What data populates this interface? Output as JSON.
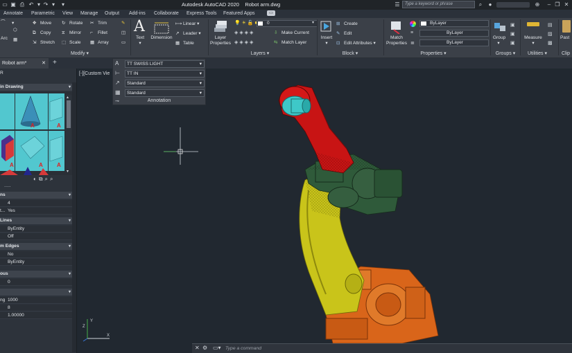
{
  "title_bar": {
    "app_title": "Autodesk AutoCAD 2020",
    "file_title": "Robot arm.dwg",
    "search_placeholder": "Type a keyword or phrase"
  },
  "menu_tabs": [
    "Annotate",
    "Parametric",
    "View",
    "Manage",
    "Output",
    "Add-ins",
    "Collaborate",
    "Express Tools",
    "Featured Apps"
  ],
  "ribbon": {
    "modify": {
      "title": "Modify",
      "tools": [
        "Move",
        "Rotate",
        "Trim",
        "Copy",
        "Mirror",
        "Fillet",
        "Stretch",
        "Scale",
        "Array"
      ],
      "left_label": "Arc"
    },
    "annotation": {
      "text_label": "Text",
      "dimension_label": "Dimension",
      "linear_label": "Linear",
      "leader_label": "Leader",
      "table_label": "Table"
    },
    "layers": {
      "title": "Layers",
      "properties_label": "Layer Properties",
      "current_layer": "0",
      "make_current": "Make Current",
      "match_layer": "Match Layer"
    },
    "block": {
      "title": "Block",
      "insert_label": "Insert",
      "create": "Create",
      "edit": "Edit",
      "edit_attributes": "Edit Attributes"
    },
    "properties": {
      "title": "Properties",
      "match_label": "Match Properties",
      "color": "ByLayer",
      "linetype": "ByLayer",
      "lineweight": "ByLayer"
    },
    "groups": {
      "title": "Groups",
      "group_label": "Group"
    },
    "utilities": {
      "title": "Utilities",
      "measure_label": "Measure"
    },
    "clipboard": {
      "label_partial": "Past",
      "title_partial": "Clip"
    }
  },
  "file_tab": {
    "label": "Robot arm*"
  },
  "annotation_popup": {
    "text_style": "TT SWISS LIGHT",
    "dim_style": "TT IN",
    "multileader_style": "Standard",
    "table_style": "Standard",
    "title": "Annotation"
  },
  "viewport": {
    "label": "[-][Custom Vie"
  },
  "palette": {
    "header_top": "R",
    "section_drawing": "in Drawing",
    "section1": "ns",
    "row1_val": "4",
    "row2_key": "t...",
    "row2_val": "Yes",
    "section_lines": "Lines",
    "lines_val1": "ByEntity",
    "lines_val2": "Off",
    "section_edges": "m Edges",
    "edges_val1": "No",
    "edges_val2": "ByEntity",
    "section_ous": "ous",
    "ous_val": "0",
    "row_ng_key": "ng",
    "row_ng_val": "1000",
    "row_8": "8",
    "row_1": "1.00000",
    "dots": "....."
  },
  "command_line": {
    "placeholder": "Type a command"
  },
  "colors": {
    "background": "#212830",
    "ribbon": "#3b4048",
    "robot_red": "#c81414",
    "robot_green": "#2f5a3a",
    "robot_yellow": "#c9c41a",
    "robot_orange": "#d9651a",
    "robot_cyan": "#3ec8c8"
  }
}
